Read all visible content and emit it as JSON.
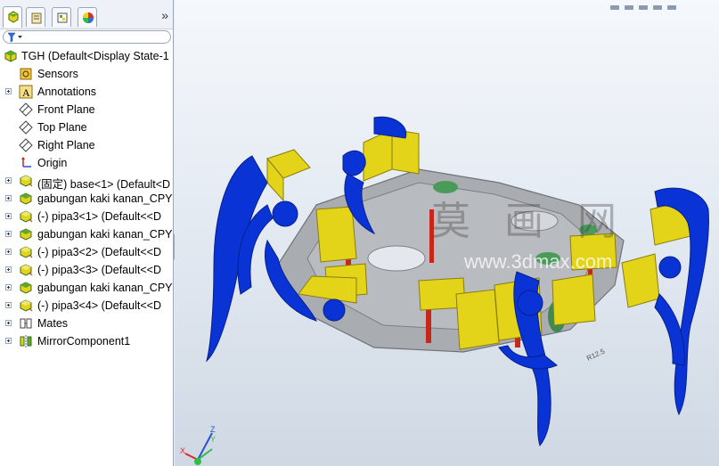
{
  "feature_tree": {
    "filter_placeholder": "",
    "root": {
      "label": "TGH  (Default<Display State-1",
      "icon": "assembly-icon"
    },
    "items": [
      {
        "label": "Sensors",
        "icon": "sensor-icon",
        "expandable": false
      },
      {
        "label": "Annotations",
        "icon": "annotation-icon",
        "expandable": true
      },
      {
        "label": "Front Plane",
        "icon": "plane-icon",
        "expandable": false
      },
      {
        "label": "Top Plane",
        "icon": "plane-icon",
        "expandable": false
      },
      {
        "label": "Right Plane",
        "icon": "plane-icon",
        "expandable": false
      },
      {
        "label": "Origin",
        "icon": "origin-icon",
        "expandable": false
      },
      {
        "label": "(固定) base<1> (Default<D",
        "icon": "part-icon",
        "expandable": true
      },
      {
        "label": "gabungan kaki kanan_CPY",
        "icon": "subassembly-icon",
        "expandable": true
      },
      {
        "label": "(-) pipa3<1> (Default<<D",
        "icon": "part-icon",
        "expandable": true
      },
      {
        "label": "gabungan kaki kanan_CPY",
        "icon": "subassembly-icon",
        "expandable": true
      },
      {
        "label": "(-) pipa3<2> (Default<<D",
        "icon": "part-icon",
        "expandable": true
      },
      {
        "label": "(-) pipa3<3> (Default<<D",
        "icon": "part-icon",
        "expandable": true
      },
      {
        "label": "gabungan kaki kanan_CPY",
        "icon": "subassembly-icon",
        "expandable": true
      },
      {
        "label": "(-) pipa3<4> (Default<<D",
        "icon": "part-icon",
        "expandable": true
      },
      {
        "label": "Mates",
        "icon": "mates-icon",
        "expandable": true
      },
      {
        "label": "MirrorComponent1",
        "icon": "mirror-icon",
        "expandable": true
      }
    ]
  },
  "tabs": [
    {
      "name": "feature-manager-tab",
      "icon": "feature-tree-icon"
    },
    {
      "name": "property-manager-tab",
      "icon": "property-icon"
    },
    {
      "name": "configuration-manager-tab",
      "icon": "configuration-icon"
    },
    {
      "name": "display-manager-tab",
      "icon": "appearance-icon"
    }
  ],
  "viewport": {
    "watermark_cn": "莫 画 网",
    "watermark_url": "www.3dmax.com",
    "triad_axes": [
      "X",
      "Y",
      "Z"
    ]
  },
  "colors": {
    "leg_blue": "#0a33d6",
    "servo_yellow": "#e3d41a",
    "frame_gray": "#a9acb0",
    "pipe_red": "#c9261b",
    "background": "#e4ebf3"
  }
}
